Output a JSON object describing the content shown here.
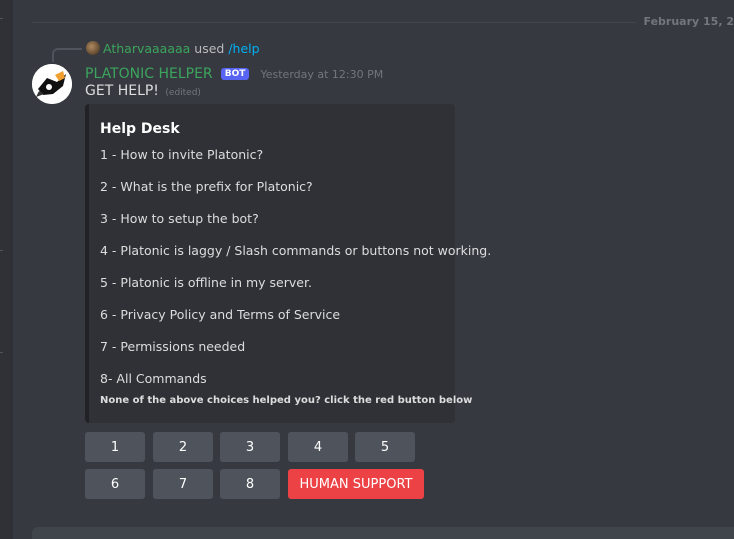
{
  "divider": {
    "date": "February 15, 2"
  },
  "reply": {
    "username": "Atharvaaaaaa",
    "used": "used",
    "command": "/help"
  },
  "message": {
    "author": "PLATONIC HELPER",
    "tag": "BOT",
    "timestamp": "Yesterday at 12:30 PM",
    "content": "GET HELP!",
    "edited": "(edited)"
  },
  "embed": {
    "title": "Help Desk",
    "lines": [
      "1 - How to invite Platonic?",
      "2 - What is the prefix for Platonic?",
      "3 - How to setup the bot?",
      "4 - Platonic is laggy / Slash commands or buttons not working.",
      "5 - Platonic is offline in my server.",
      "6 - Privacy Policy and Terms of Service",
      "7 - Permissions needed",
      "8- All Commands"
    ],
    "footer": "None of the above choices helped you? click the red button below"
  },
  "buttons": [
    "1",
    "2",
    "3",
    "4",
    "5",
    "6",
    "7",
    "8",
    "HUMAN SUPPORT"
  ],
  "colors": {
    "bot_name": "#3ba55d",
    "bot_tag": "#5865f2",
    "support_button": "#ed4245",
    "command": "#00aff4"
  }
}
